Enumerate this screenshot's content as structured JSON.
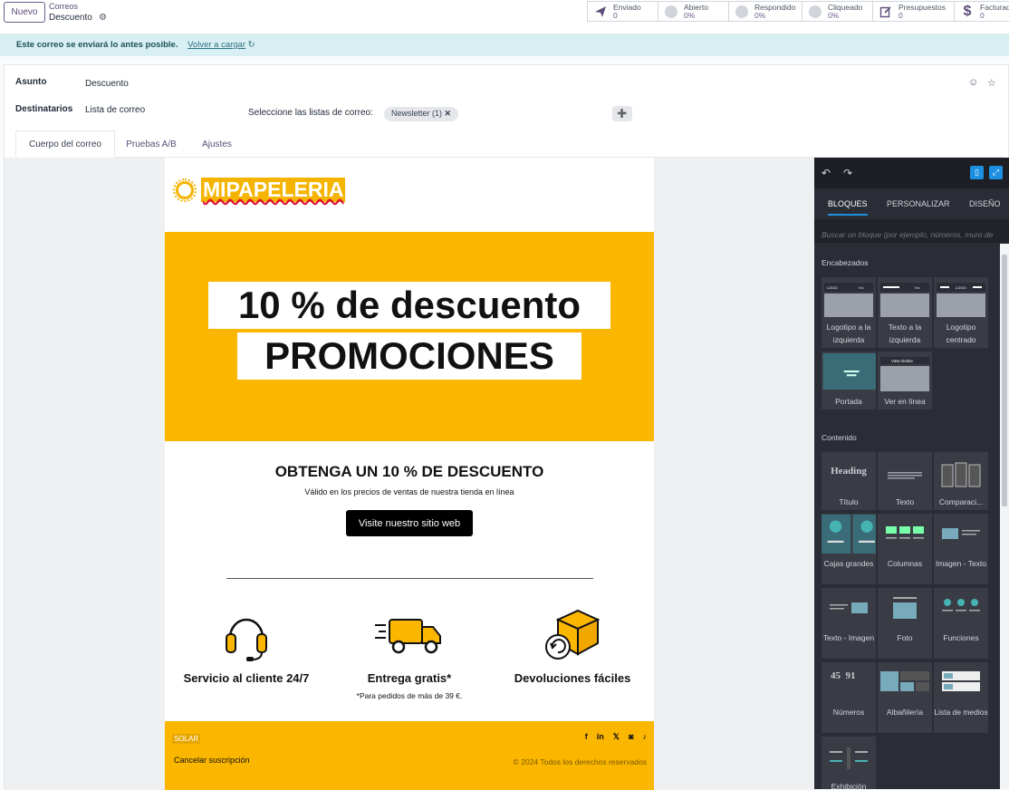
{
  "header": {
    "new_button": "Nuevo",
    "breadcrumb_parent": "Correos",
    "breadcrumb_current": "Descuento",
    "stats": [
      {
        "label": "Enviado",
        "value": "0",
        "icon": "paper-plane-icon"
      },
      {
        "label": "Abierto",
        "value": "0%",
        "icon": "circle-progress-icon"
      },
      {
        "label": "Respondido",
        "value": "0%",
        "icon": "circle-progress-icon"
      },
      {
        "label": "Cliqueado",
        "value": "0%",
        "icon": "circle-progress-icon"
      },
      {
        "label": "Presupuestos",
        "value": "0",
        "icon": "edit-icon"
      },
      {
        "label": "Facturado",
        "value": "0",
        "icon": "dollar-icon"
      }
    ]
  },
  "notice": {
    "text": "Este correo se enviará lo antes posible.",
    "action": "Volver a cargar"
  },
  "form": {
    "subject_label": "Asunto",
    "subject_value": "Descuento",
    "recipients_label": "Destinatarios",
    "recipients_value": "Lista de correo",
    "lists_label": "Seleccione las listas de correo:",
    "list_tag": "Newsletter (1)"
  },
  "tabs": [
    "Cuerpo del correo",
    "Pruebas A/B",
    "Ajustes"
  ],
  "email": {
    "brand": "MIPAPELERIA",
    "hero_line1": "10 % de descuento",
    "hero_line2": "PROMOCIONES",
    "offer_title": "OBTENGA UN 10 % DE DESCUENTO",
    "offer_subtitle": "Válido en los precios de ventas de nuestra tienda en línea",
    "cta": "Visite nuestro sitio web",
    "features": [
      {
        "title": "Servicio al cliente 24/7",
        "sub": "",
        "icon": "headset-icon"
      },
      {
        "title": "Entrega gratis*",
        "sub": "*Para pedidos de más de 39 €.",
        "icon": "delivery-truck-icon"
      },
      {
        "title": "Devoluciones fáciles",
        "sub": "",
        "icon": "return-box-icon"
      }
    ],
    "footer_brand": "SOLAR",
    "unsubscribe": "Cancelar suscripción",
    "copyright": "© 2024 Todos los derechos reservados",
    "brand_color": "#fbb600"
  },
  "panel": {
    "tabs": [
      "BLOQUES",
      "PERSONALIZAR",
      "DISEÑO"
    ],
    "search_placeholder": "Buscar un bloque (por ejemplo, números, muro de",
    "sections": [
      {
        "title": "Encabezados",
        "blocks": [
          "Logotipo a la izquierda",
          "Texto a la izquierda",
          "Logotipo centrado",
          "Portada",
          "Ver en línea"
        ]
      },
      {
        "title": "Contenido",
        "blocks": [
          "Título",
          "Texto",
          "Comparaci...",
          "Cajas grandes",
          "Columnas",
          "Imagen - Texto",
          "Texto - Imagen",
          "Foto",
          "Funciones",
          "Números",
          "Albañilería",
          "Lista de medios",
          "Exhibición"
        ]
      }
    ],
    "thumb_texts": {
      "logo": "LOGO",
      "view_online": "View Online",
      "heading": "Heading",
      "num1": "45",
      "num2": "91"
    }
  }
}
